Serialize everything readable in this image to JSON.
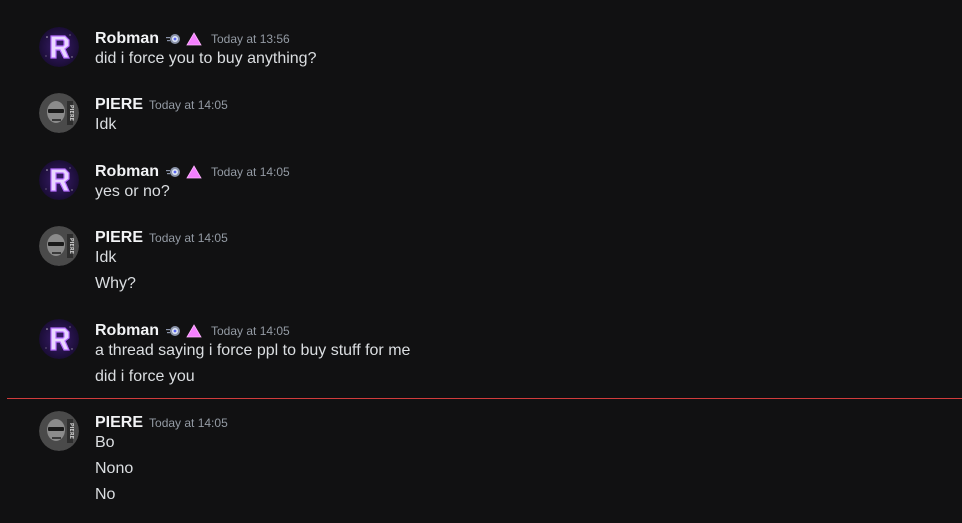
{
  "messages": [
    {
      "author": "Robman",
      "avatar_icon": "robman-r-logo-avatar",
      "badges": [
        "nitro-orb-badge-icon",
        "triangle-badge-icon"
      ],
      "timestamp": "Today at 13:56",
      "lines": [
        "did i force you to buy anything?"
      ]
    },
    {
      "author": "PIERE",
      "avatar_icon": "piere-portrait-avatar",
      "badges": [],
      "timestamp": "Today at 14:05",
      "lines": [
        "Idk"
      ]
    },
    {
      "author": "Robman",
      "avatar_icon": "robman-r-logo-avatar",
      "badges": [
        "nitro-orb-badge-icon",
        "triangle-badge-icon"
      ],
      "timestamp": "Today at 14:05",
      "lines": [
        "yes or no?"
      ]
    },
    {
      "author": "PIERE",
      "avatar_icon": "piere-portrait-avatar",
      "badges": [],
      "timestamp": "Today at 14:05",
      "lines": [
        "Idk",
        "Why?"
      ]
    },
    {
      "author": "Robman",
      "avatar_icon": "robman-r-logo-avatar",
      "badges": [
        "nitro-orb-badge-icon",
        "triangle-badge-icon"
      ],
      "timestamp": "Today at 14:05",
      "lines": [
        "a thread saying i force ppl to buy stuff for me",
        "did i force you"
      ]
    },
    {
      "author": "PIERE",
      "avatar_icon": "piere-portrait-avatar",
      "badges": [],
      "timestamp": "Today at 14:05",
      "lines": [
        "Bo",
        "Nono",
        "No"
      ]
    }
  ],
  "colors": {
    "background": "#111112",
    "username": "#f2f3f5",
    "message_text": "#dbdee1",
    "timestamp": "#949ba4",
    "new_messages_divider": "#d13c3c",
    "triangle_badge": "#f47fff"
  }
}
